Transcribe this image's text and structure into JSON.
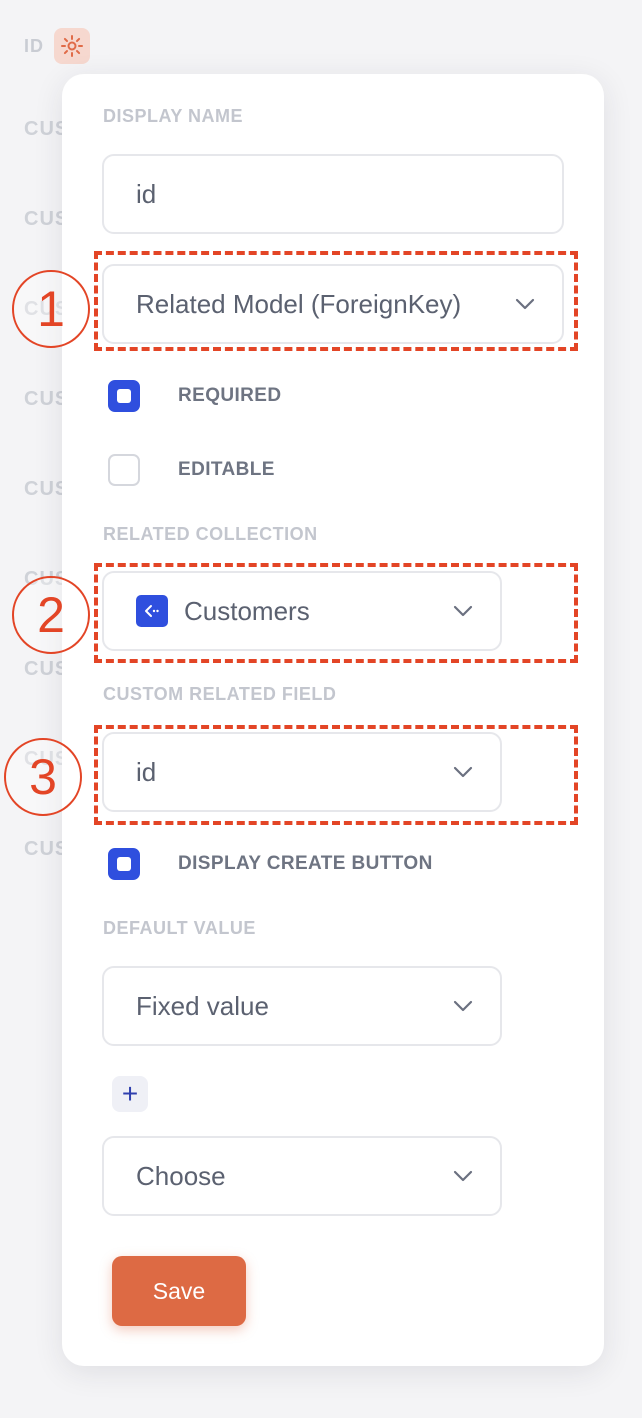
{
  "background": {
    "column_label": "ID",
    "rows": [
      "CUS",
      "CUS",
      "CUS",
      "CUS",
      "CUS",
      "CUS",
      "CUS",
      "CUS",
      "CUS"
    ]
  },
  "panel": {
    "display_name_label": "DISPLAY NAME",
    "display_name_value": "id",
    "field_type_value": "Related Model (ForeignKey)",
    "required_label": "REQUIRED",
    "required_checked": true,
    "editable_label": "EDITABLE",
    "editable_checked": false,
    "related_collection_label": "RELATED COLLECTION",
    "related_collection_value": "Customers",
    "custom_related_field_label": "CUSTOM RELATED FIELD",
    "custom_related_field_value": "id",
    "display_create_button_label": "DISPLAY CREATE BUTTON",
    "display_create_button_checked": true,
    "default_value_label": "DEFAULT VALUE",
    "default_value_mode": "Fixed value",
    "add_label": "+",
    "choose_placeholder": "Choose",
    "save_label": "Save"
  },
  "annotations": [
    "1",
    "2",
    "3"
  ],
  "colors": {
    "accent_blue": "#2f4fde",
    "save_orange": "#dd6a44",
    "annotation_red": "#e34526"
  }
}
